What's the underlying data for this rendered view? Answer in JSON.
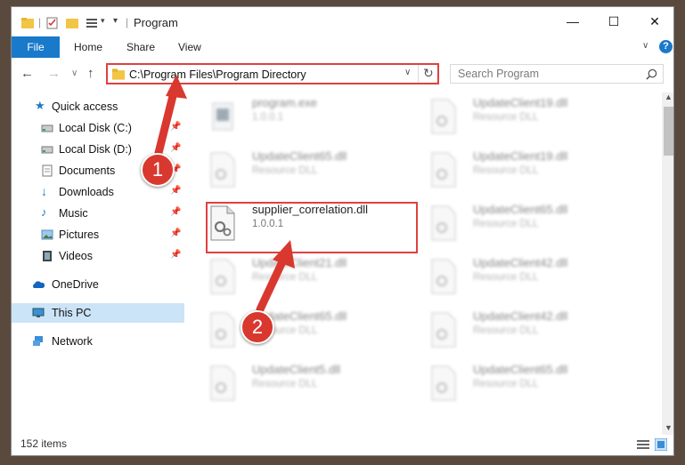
{
  "window": {
    "title": "Program",
    "controls": {
      "minimize": "—",
      "maximize": "☐",
      "close": "✕"
    }
  },
  "ribbon": {
    "tabs": [
      "File",
      "Home",
      "Share",
      "View"
    ]
  },
  "address": {
    "path": "C:\\Program Files\\Program Directory",
    "search_placeholder": "Search Program"
  },
  "sidebar": {
    "quick_access": "Quick access",
    "items": [
      {
        "label": "Local Disk (C:)",
        "icon": "drive-icon"
      },
      {
        "label": "Local Disk (D:)",
        "icon": "drive-icon"
      },
      {
        "label": "Documents",
        "icon": "documents-icon"
      },
      {
        "label": "Downloads",
        "icon": "downloads-icon"
      },
      {
        "label": "Music",
        "icon": "music-icon"
      },
      {
        "label": "Pictures",
        "icon": "pictures-icon"
      },
      {
        "label": "Videos",
        "icon": "videos-icon"
      }
    ],
    "onedrive": "OneDrive",
    "this_pc": "This PC",
    "network": "Network"
  },
  "files": {
    "left": [
      {
        "name": "program.exe",
        "desc": "1.0.0.1"
      },
      {
        "name": "UpdateClient65.dll",
        "desc": "Resource DLL"
      },
      {
        "name": "supplier_correlation.dll",
        "desc": "1.0.0.1"
      },
      {
        "name": "UpdateClient21.dll",
        "desc": "Resource DLL"
      },
      {
        "name": "UpdateClient65.dll",
        "desc": "Resource DLL"
      },
      {
        "name": "UpdateClient5.dll",
        "desc": "Resource DLL"
      }
    ],
    "right": [
      {
        "name": "UpdateClient19.dll",
        "desc": "Resource DLL"
      },
      {
        "name": "UpdateClient19.dll",
        "desc": "Resource DLL"
      },
      {
        "name": "UpdateClient65.dll",
        "desc": "Resource DLL"
      },
      {
        "name": "UpdateClient42.dll",
        "desc": "Resource DLL"
      },
      {
        "name": "UpdateClient42.dll",
        "desc": "Resource DLL"
      },
      {
        "name": "UpdateClient65.dll",
        "desc": "Resource DLL"
      }
    ]
  },
  "status": {
    "count": "152 items"
  },
  "annotations": {
    "step1": "1",
    "step2": "2",
    "color": "#d9382f"
  }
}
